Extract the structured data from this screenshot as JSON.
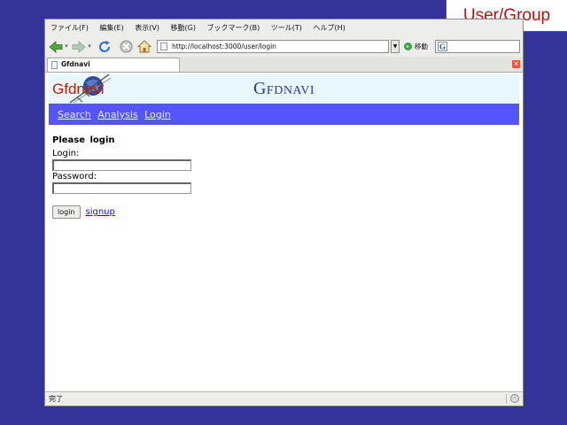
{
  "slide": {
    "label": "User/Group"
  },
  "browser": {
    "menu": [
      "ファイル(F)",
      "編集(E)",
      "表示(V)",
      "移動(G)",
      "ブックマーク(B)",
      "ツール(T)",
      "ヘルプ(H)"
    ],
    "url": "http://localhost:3000/user/login",
    "go_label": "移動",
    "tab_title": "Gfdnavi",
    "status_text": "完了"
  },
  "site": {
    "logo_text": "Gfdnavi",
    "title": "Gfdnavi",
    "nav": [
      "Search",
      "Analysis",
      "Login"
    ]
  },
  "form": {
    "heading": "Please login",
    "login_label": "Login:",
    "login_value": "",
    "password_label": "Password:",
    "password_value": "",
    "login_button": "login",
    "signup_link": "signup"
  },
  "colors": {
    "background": "#333399",
    "slide_label_text": "#b31414",
    "header_bg": "#e8f6fd",
    "logo_text": "#bb2200",
    "title_text": "#3333aa",
    "nav_bar": "#5555ff",
    "link": "#1111cc"
  }
}
